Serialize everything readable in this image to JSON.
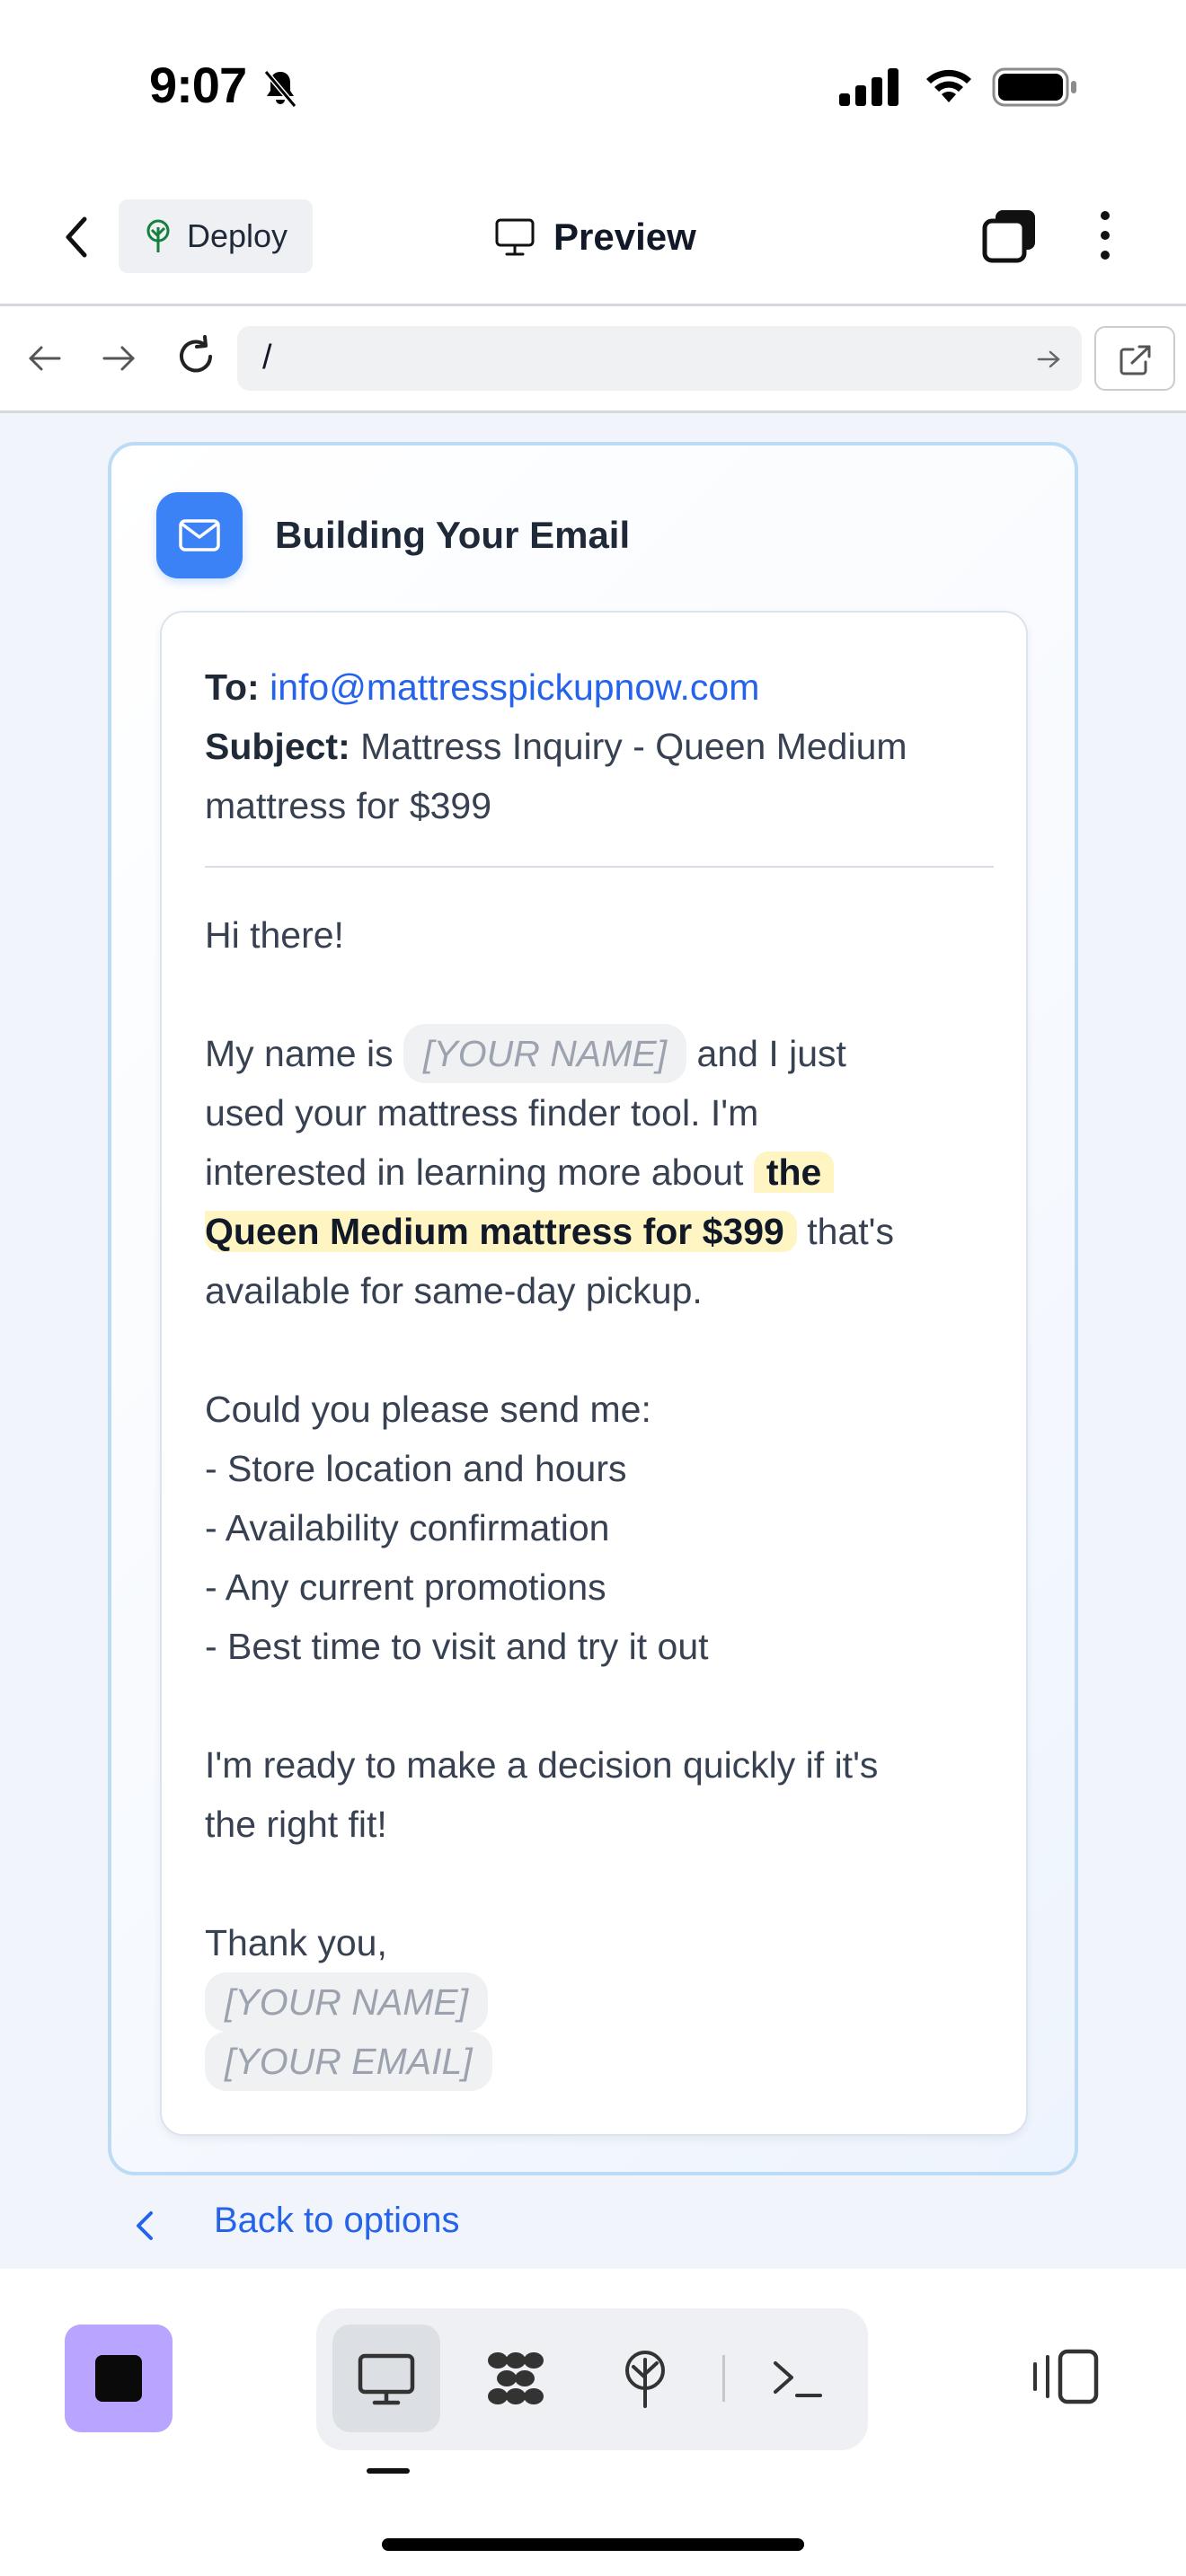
{
  "status_bar": {
    "time": "9:07"
  },
  "header": {
    "deploy_label": "Deploy",
    "title": "Preview"
  },
  "url_bar": {
    "url": "/"
  },
  "card": {
    "title": "Building Your Email",
    "email": {
      "to_label": "To:",
      "to_address": "info@mattresspickupnow.com",
      "subject_label": "Subject:",
      "subject_line1": "Mattress Inquiry - Queen Medium",
      "subject_line2": "mattress for $399",
      "greeting": "Hi there!",
      "p1_a": "My name is",
      "name_placeholder": "[YOUR NAME]",
      "p1_b": "and I just",
      "p1_line2": "used your mattress finder tool. I'm",
      "p1_line3": "interested in learning more about",
      "highlight_a": "the",
      "highlight_b": "Queen Medium mattress for $399",
      "p1_c": "that's",
      "p1_line5": "available for same-day pickup.",
      "request_intro": "Could you please send me:",
      "requests": [
        "- Store location and hours",
        "- Availability confirmation",
        "- Any current promotions",
        "- Best time to visit and try it out"
      ],
      "closing_line1": "I'm ready to make a decision quickly if it's",
      "closing_line2": "the right fit!",
      "signoff": "Thank you,",
      "sig_name": "[YOUR NAME]",
      "sig_email": "[YOUR EMAIL]"
    }
  },
  "back_link": "Back to options",
  "colors": {
    "accent_blue": "#3b82f6",
    "link_blue": "#2563eb",
    "highlight": "#fef5c3",
    "stop_button": "#b9a4ff"
  },
  "toolbar": {
    "items": [
      "desktop-preview-icon",
      "apps-grid-icon",
      "deploy-tree-icon",
      "terminal-icon"
    ],
    "active": "desktop-preview-icon"
  }
}
